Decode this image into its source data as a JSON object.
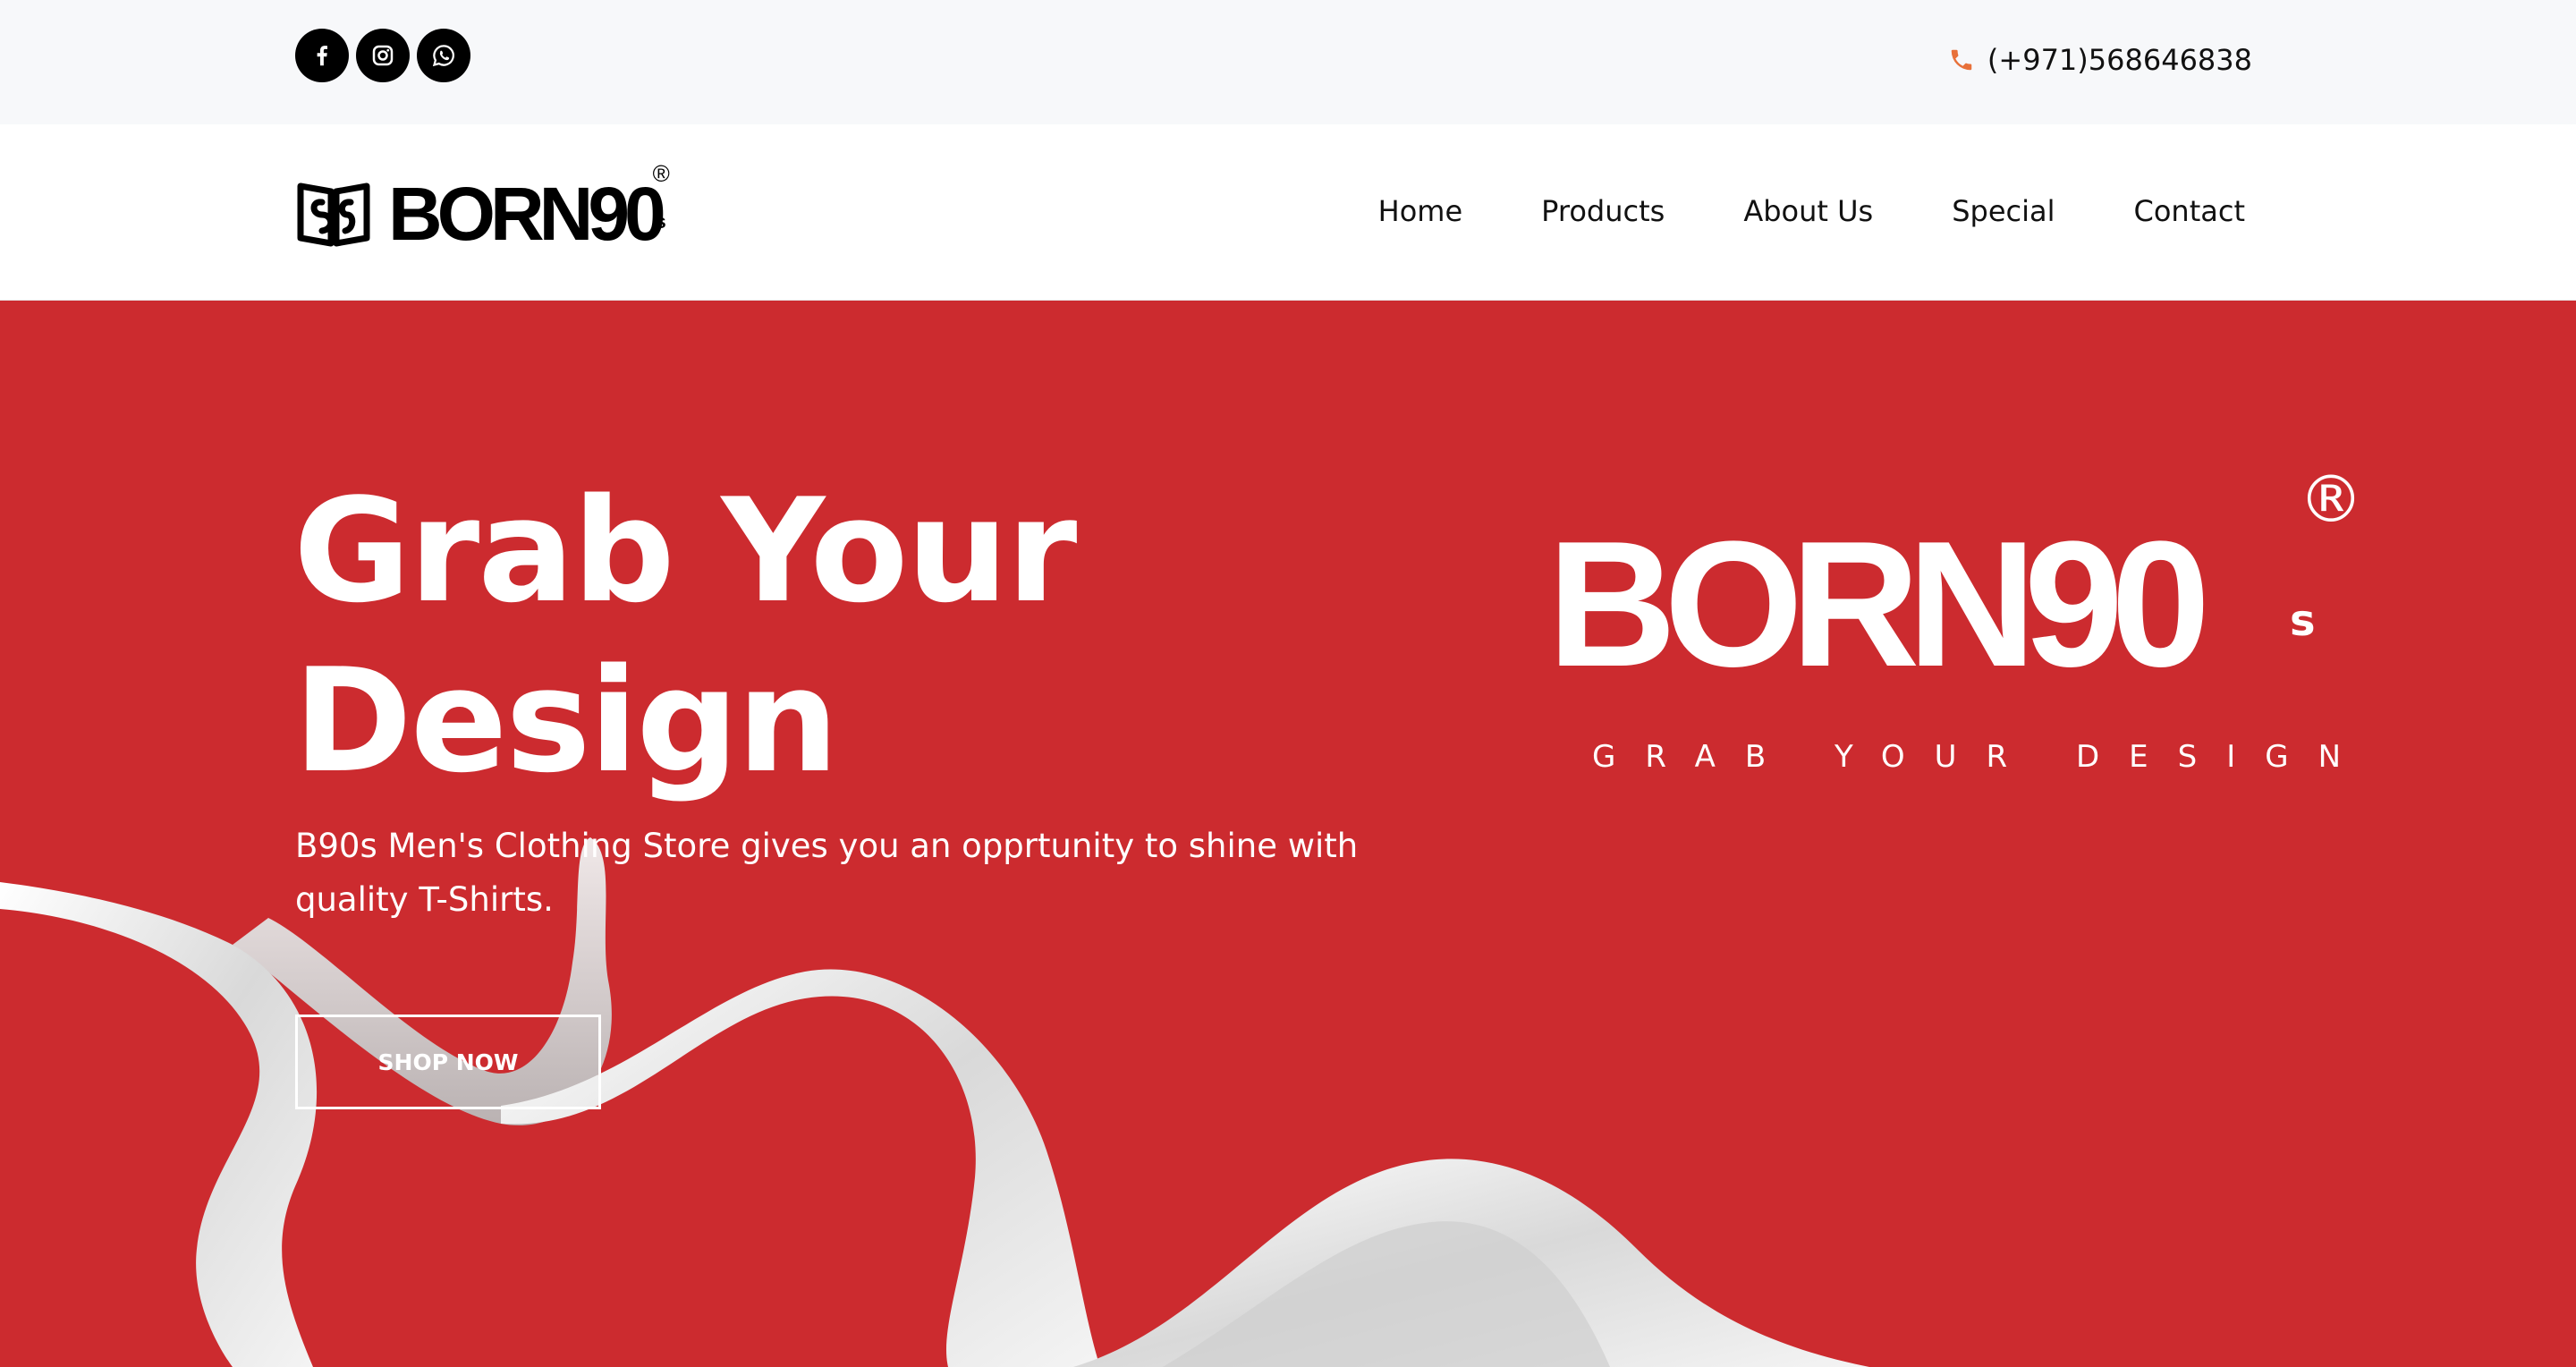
{
  "topbar": {
    "social": [
      {
        "icon": "facebook-icon",
        "label": "Facebook"
      },
      {
        "icon": "instagram-icon",
        "label": "Instagram"
      },
      {
        "icon": "whatsapp-icon",
        "label": "WhatsApp"
      }
    ],
    "phone": "(+971)568646838",
    "phone_icon_color": "#e8713a"
  },
  "nav": {
    "logo_text": "BORN90",
    "logo_sup": "s",
    "logo_reg": "®",
    "items": [
      "Home",
      "Products",
      "About Us",
      "Special",
      "Contact"
    ]
  },
  "hero": {
    "title": "Grab Your Design",
    "subtitle": "B90s Men's Clothing Store gives you an opprtunity to shine with quality T-Shirts.",
    "cta": "SHOP NOW",
    "brand_word": "BORN90",
    "brand_sup": "s",
    "brand_reg": "®",
    "brand_tagline": "GRAB YOUR DESIGN",
    "background_color": "#cc2b2f"
  }
}
